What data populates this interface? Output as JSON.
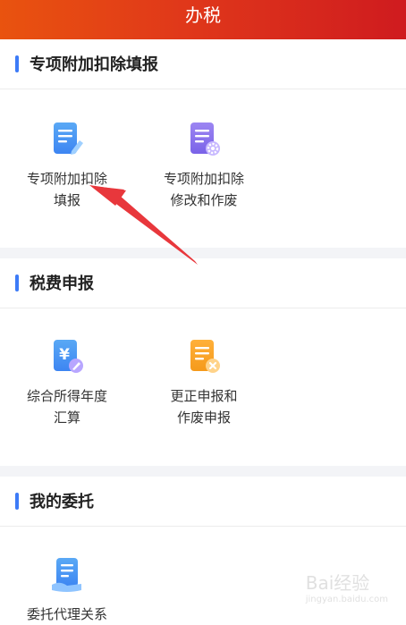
{
  "header": {
    "title": "办税"
  },
  "sections": [
    {
      "title": "专项附加扣除填报",
      "items": [
        {
          "line1": "专项附加扣除",
          "line2": "填报",
          "icon": "document-edit-icon"
        },
        {
          "line1": "专项附加扣除",
          "line2": "修改和作废",
          "icon": "document-gear-icon"
        }
      ]
    },
    {
      "title": "税费申报",
      "items": [
        {
          "line1": "综合所得年度",
          "line2": "汇算",
          "icon": "yuan-document-icon"
        },
        {
          "line1": "更正申报和",
          "line2": "作废申报",
          "icon": "document-cancel-icon"
        }
      ]
    },
    {
      "title": "我的委托",
      "items": [
        {
          "line1": "委托代理关系",
          "line2": "",
          "icon": "document-hand-icon"
        }
      ]
    }
  ],
  "watermark": {
    "text": "Bai经验",
    "sub": "jingyan.baidu.com"
  },
  "colors": {
    "header_start": "#e9530f",
    "header_end": "#cf1b1f",
    "accent": "#3d7bf7",
    "arrow": "#e8373c"
  }
}
